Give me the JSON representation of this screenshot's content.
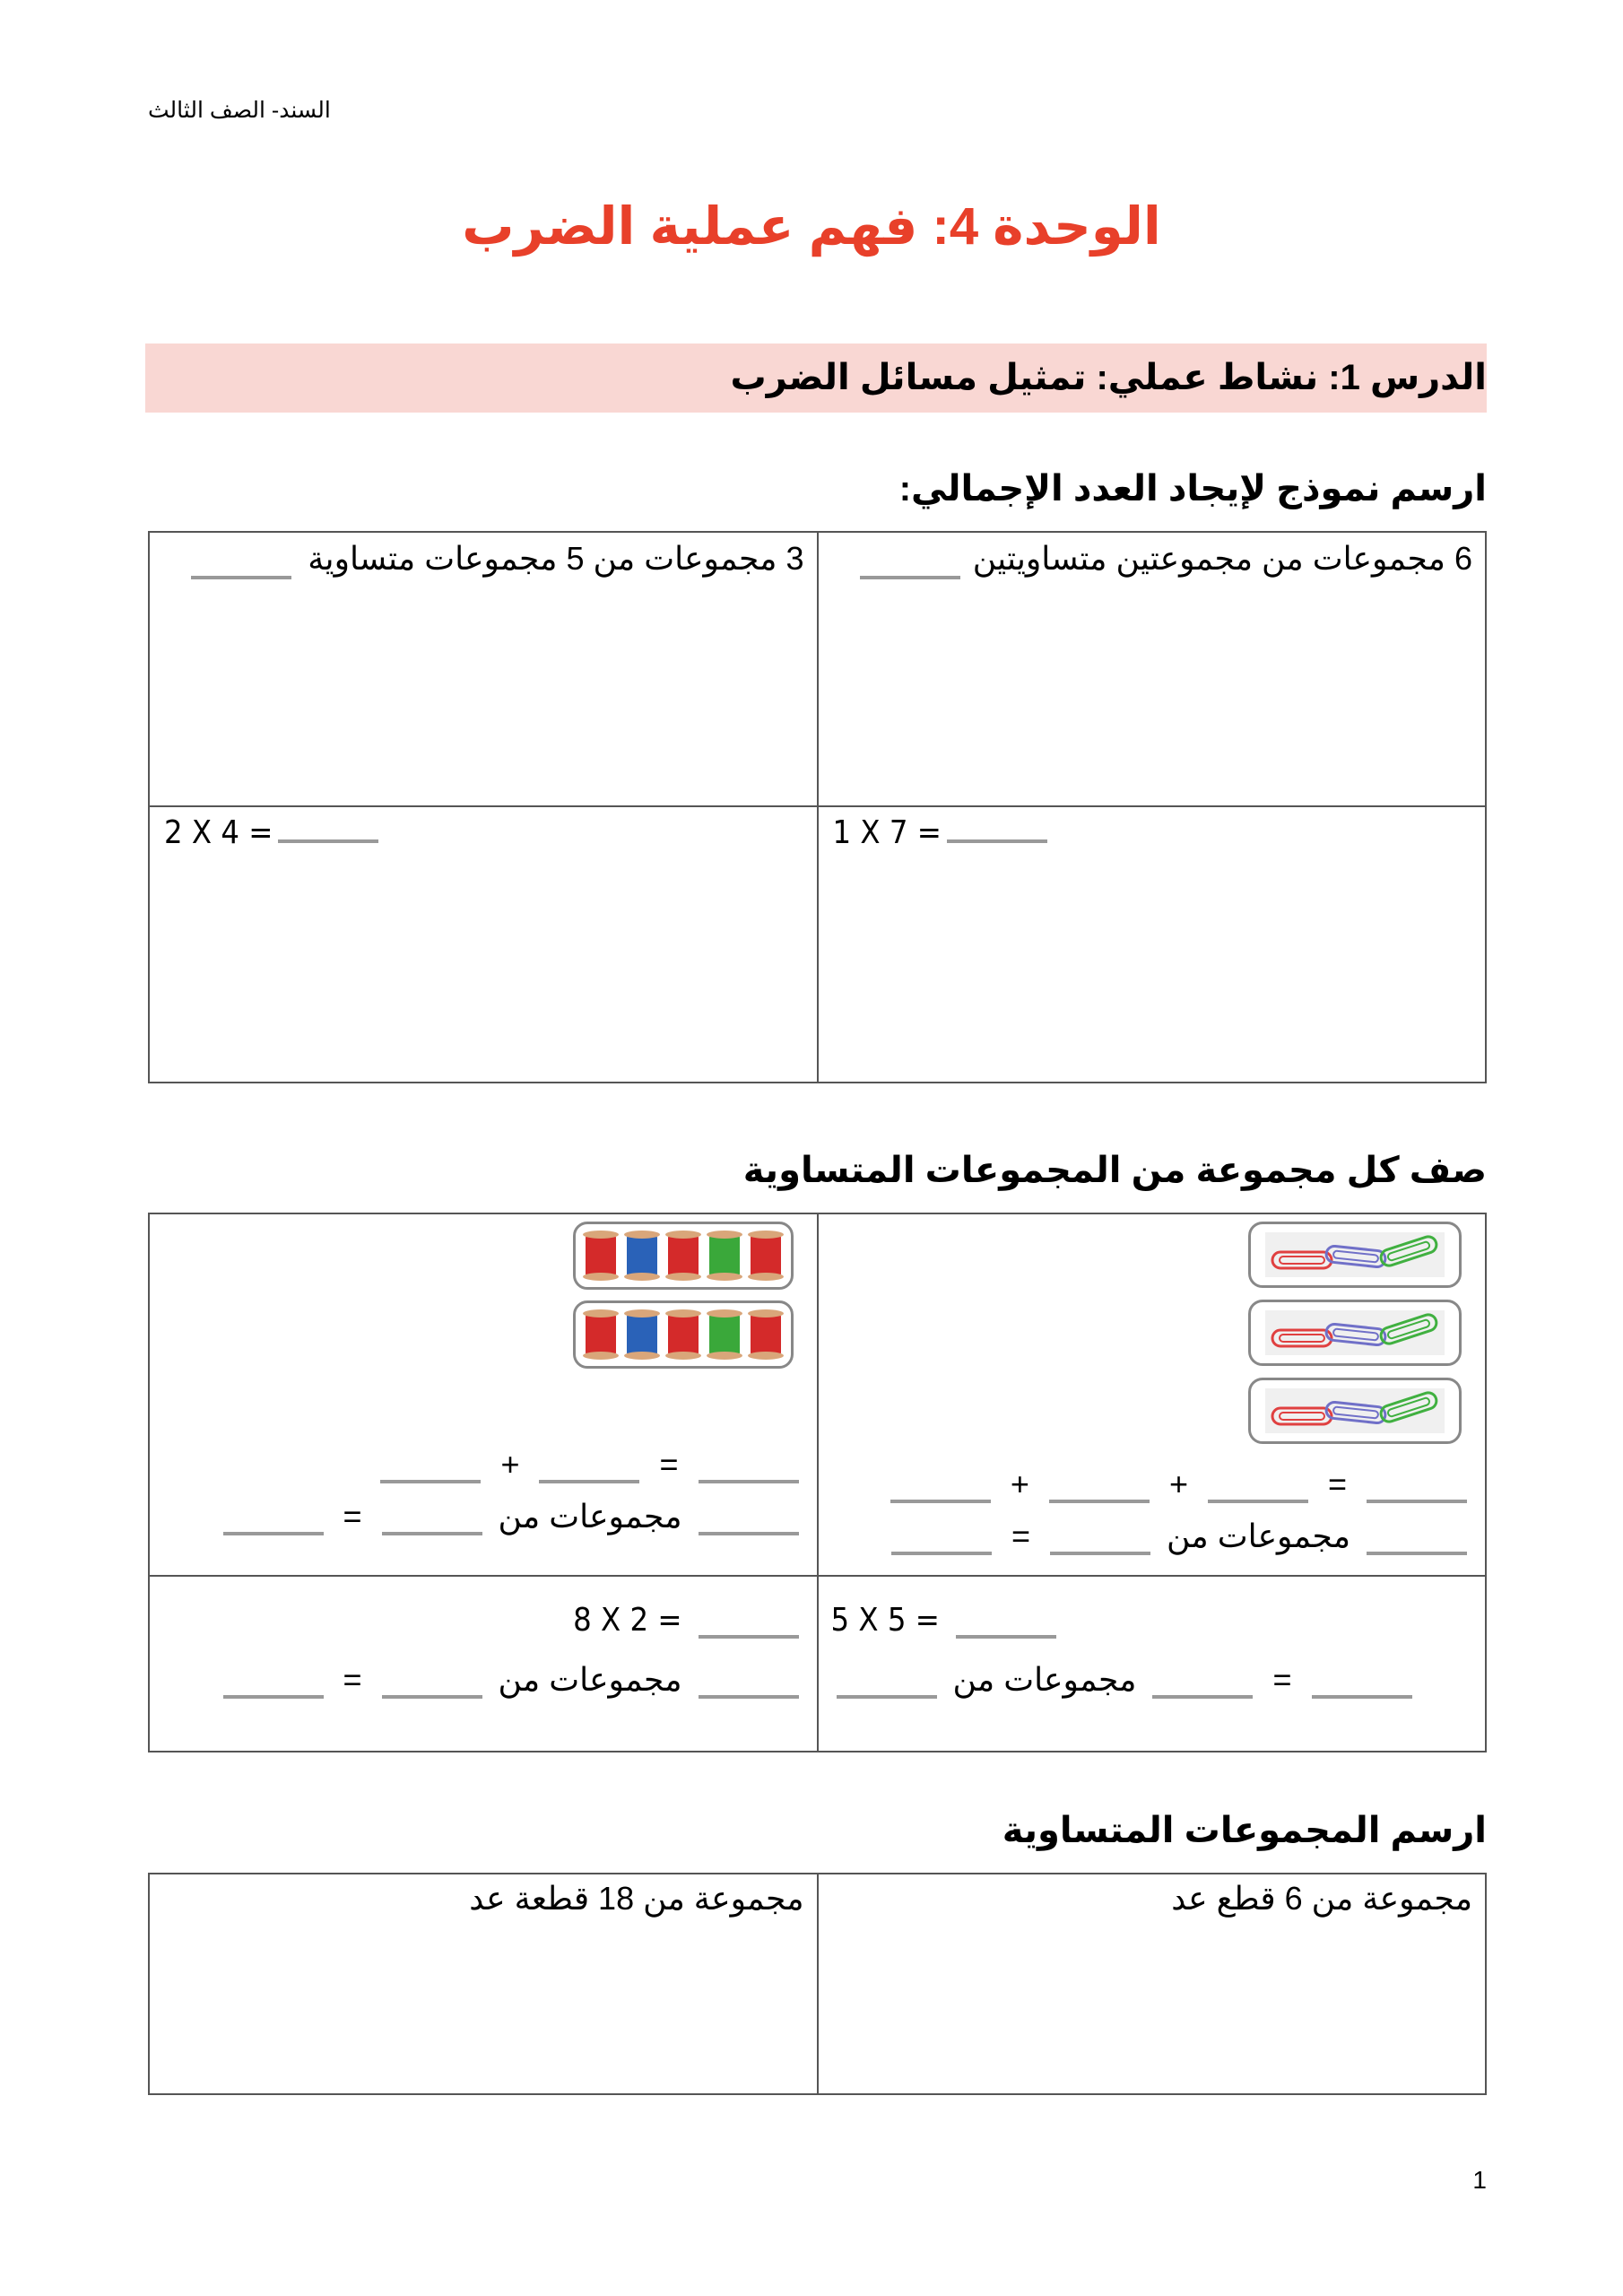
{
  "header": {
    "note": "السند- الصف الثالث"
  },
  "unit": {
    "title": "الوحدة 4: فهم عملية الضرب",
    "color": "#e8402a"
  },
  "lesson": {
    "title": "الدرس 1: نشاط عملي: تمثيل مسائل الضرب",
    "bar_color": "#f9d7d3"
  },
  "section1": {
    "title": "ارسم نموذج لإيجاد العدد الإجمالي:",
    "cells": [
      {
        "text": "6 مجموعات من مجموعتين متساويتين"
      },
      {
        "text": "3 مجموعات من 5 مجموعات متساوية"
      },
      {
        "equation": "1 X 7 ="
      },
      {
        "equation": "2 X 4 ="
      }
    ]
  },
  "section2": {
    "title": "صف كل مجموعة من المجموعات المتساوية",
    "paperclips": {
      "groups": 3,
      "colors": [
        "#e04040",
        "#7070c8",
        "#40b040"
      ]
    },
    "spools": {
      "groups": 2,
      "colors": [
        "#d42a2a",
        "#2a62b8",
        "#d42a2a",
        "#3aa83a",
        "#d42a2a"
      ]
    },
    "groups_of_label": "مجموعات من",
    "plus": "+",
    "equals": "=",
    "eq_5x5": "5 X 5 =",
    "eq_8x2": "8 X 2 ="
  },
  "section3": {
    "title": "ارسم المجموعات المتساوية",
    "cells": [
      {
        "text": "مجموعة من 6 قطع عد"
      },
      {
        "text": "مجموعة من 18 قطعة عد"
      }
    ]
  },
  "footer": {
    "page_number": "1"
  }
}
